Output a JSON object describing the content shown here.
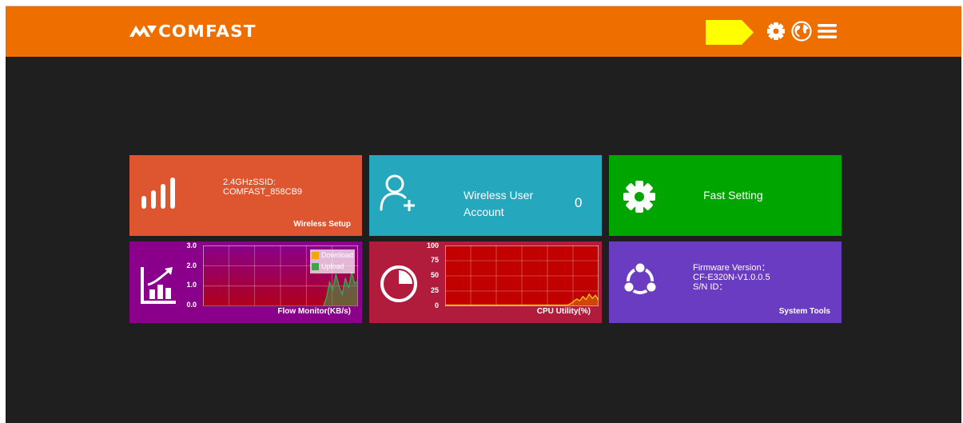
{
  "header": {
    "brand": "COMFAST",
    "icons": [
      "flag-tag",
      "gear-icon",
      "globe-icon",
      "menu-icon"
    ]
  },
  "tiles": {
    "wireless": {
      "ssid_label": "2.4GHzSSID:",
      "ssid_value": "COMFAST_858CB9",
      "footer": "Wireless Setup",
      "icon": "signal-bars-icon"
    },
    "users": {
      "title_line1": "Wireless User",
      "title_line2": "Account",
      "count": "0",
      "icon": "add-user-icon"
    },
    "fast": {
      "title": "Fast Setting",
      "icon": "gear-icon"
    },
    "flow": {
      "footer": "Flow Monitor(KB/s)",
      "icon": "growth-chart-icon"
    },
    "cpu": {
      "footer": "CPU Utility(%)",
      "icon": "pie-icon"
    },
    "system": {
      "fw_label": "Firmware Version：",
      "fw_value": "CF-E320N-V1.0.0.5",
      "sn_label": "S/N ID：",
      "footer": "System Tools",
      "icon": "share-circle-icon"
    }
  },
  "chart_data": [
    {
      "type": "line",
      "title": "Flow Monitor(KB/s)",
      "yticks": [
        "3.0",
        "2.0",
        "1.0",
        "0.0"
      ],
      "ylim": [
        0,
        3
      ],
      "legend": [
        "Download",
        "Upload"
      ],
      "series": [
        {
          "name": "Download",
          "values": [
            0,
            0,
            0,
            0,
            0,
            0,
            0,
            0,
            0,
            0,
            0,
            0,
            0,
            0,
            0,
            0,
            0,
            0,
            0,
            0,
            0,
            0,
            0,
            0,
            0,
            0,
            0,
            0,
            0,
            0,
            0,
            0,
            0,
            0,
            0,
            0,
            0,
            0,
            0,
            0,
            0,
            0,
            0,
            0,
            0,
            0,
            0,
            0,
            0,
            0
          ]
        },
        {
          "name": "Upload",
          "values": [
            0,
            0,
            0,
            0,
            0,
            0,
            0,
            0,
            0,
            0,
            0,
            0,
            0,
            0,
            0,
            0,
            0,
            0,
            0,
            0,
            0,
            0,
            0,
            0,
            0,
            0,
            0,
            0,
            0,
            0,
            0,
            0,
            0,
            0,
            0,
            0,
            0,
            0,
            0,
            0.4,
            1.2,
            0.8,
            1.6,
            1.0,
            0.6,
            1.4,
            0.9,
            1.7,
            1.1,
            1.3
          ]
        }
      ]
    },
    {
      "type": "area",
      "title": "CPU Utility(%)",
      "yticks": [
        "100",
        "75",
        "50",
        "25",
        "0"
      ],
      "ylim": [
        0,
        100
      ],
      "series": [
        {
          "name": "",
          "values": [
            2,
            2,
            2,
            2,
            2,
            2,
            2,
            2,
            2,
            2,
            2,
            2,
            2,
            2,
            2,
            2,
            2,
            2,
            2,
            2,
            2,
            2,
            2,
            2,
            2,
            2,
            2,
            2,
            2,
            2,
            2,
            2,
            2,
            2,
            2,
            2,
            2,
            2,
            2,
            2,
            4,
            8,
            12,
            9,
            16,
            11,
            20,
            13,
            18,
            10
          ]
        }
      ]
    }
  ]
}
